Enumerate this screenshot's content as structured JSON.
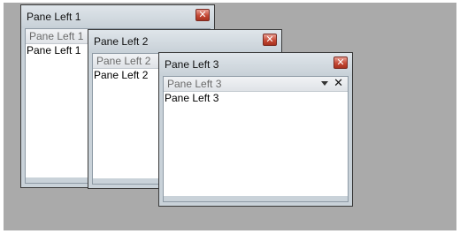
{
  "windows": [
    {
      "title": "Pane Left 1",
      "pane_header": "Pane Left 1",
      "content": "Pane Left 1",
      "close_glyph": "✕",
      "icons": [
        "close-icon"
      ]
    },
    {
      "title": "Pane Left 2",
      "pane_header": "Pane Left 2",
      "content": "Pane Left 2",
      "close_glyph": "✕",
      "icons": [
        "close-icon"
      ]
    },
    {
      "title": "Pane Left 3",
      "pane_header": "Pane Left 3",
      "content": "Pane Left 3",
      "close_glyph": "✕",
      "pane_close_glyph": "✕",
      "icons": [
        "close-icon",
        "chevron-down-icon",
        "pane-close-icon"
      ]
    }
  ],
  "colors": {
    "desktop_background": "#aaaaaa",
    "window_frame": "#c9d2d9",
    "close_button": "#c64935",
    "pane_header_text": "#6b6b6b"
  }
}
